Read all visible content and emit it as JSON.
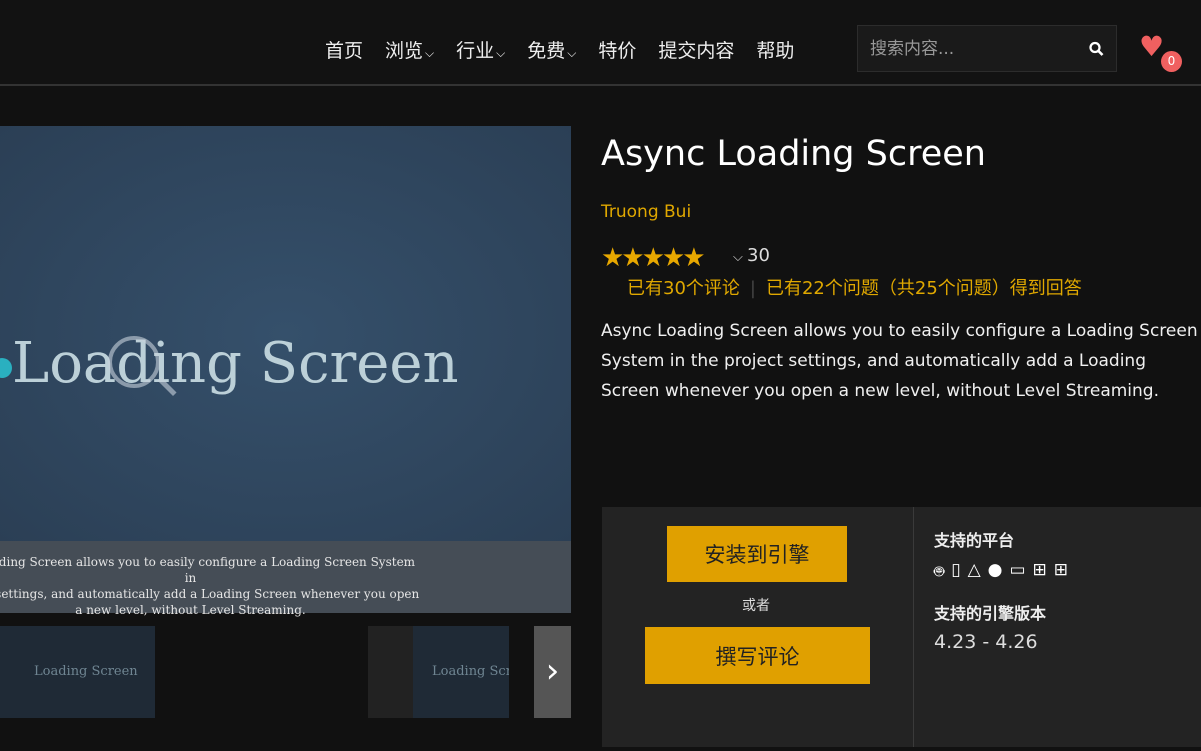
{
  "nav": {
    "items": [
      "首页",
      "浏览",
      "行业",
      "免费",
      "特价",
      "提交内容",
      "帮助"
    ],
    "search_placeholder": "搜索内容...",
    "cart_count": "0"
  },
  "gallery": {
    "hero_title": "Loading Screen",
    "caption_lines": [
      "c Loading Screen allows you to easily configure a Loading Screen System in",
      "oject settings, and automatically add a Loading Screen whenever you open",
      "a new level, without Level Streaming."
    ],
    "thumb1": "Loading Screen",
    "thumb2": "Loading Scr"
  },
  "product": {
    "title": "Async Loading Screen",
    "author": "Truong Bui",
    "stars": "★★★★★",
    "rating_count": "30",
    "reviews_link": "已有30个评论",
    "questions_link": "已有22个问题（共25个问题）得到回答",
    "description": "Async Loading Screen allows you to easily configure a Loading Screen System in the project settings, and automatically add a Loading Screen whenever you open a new level, without Level Streaming."
  },
  "actions": {
    "install": "安装到引擎",
    "or": "或者",
    "review": "撰写评论"
  },
  "info": {
    "platforms_label": "支持的平台",
    "platforms": [
      "android",
      "ios",
      "linux",
      "mac",
      "laptop",
      "windows",
      "windows"
    ],
    "engine_label": "支持的引擎版本",
    "engine_versions": "4.23 - 4.26"
  },
  "colors": {
    "accent": "#e0a000",
    "heart": "#f06060"
  }
}
